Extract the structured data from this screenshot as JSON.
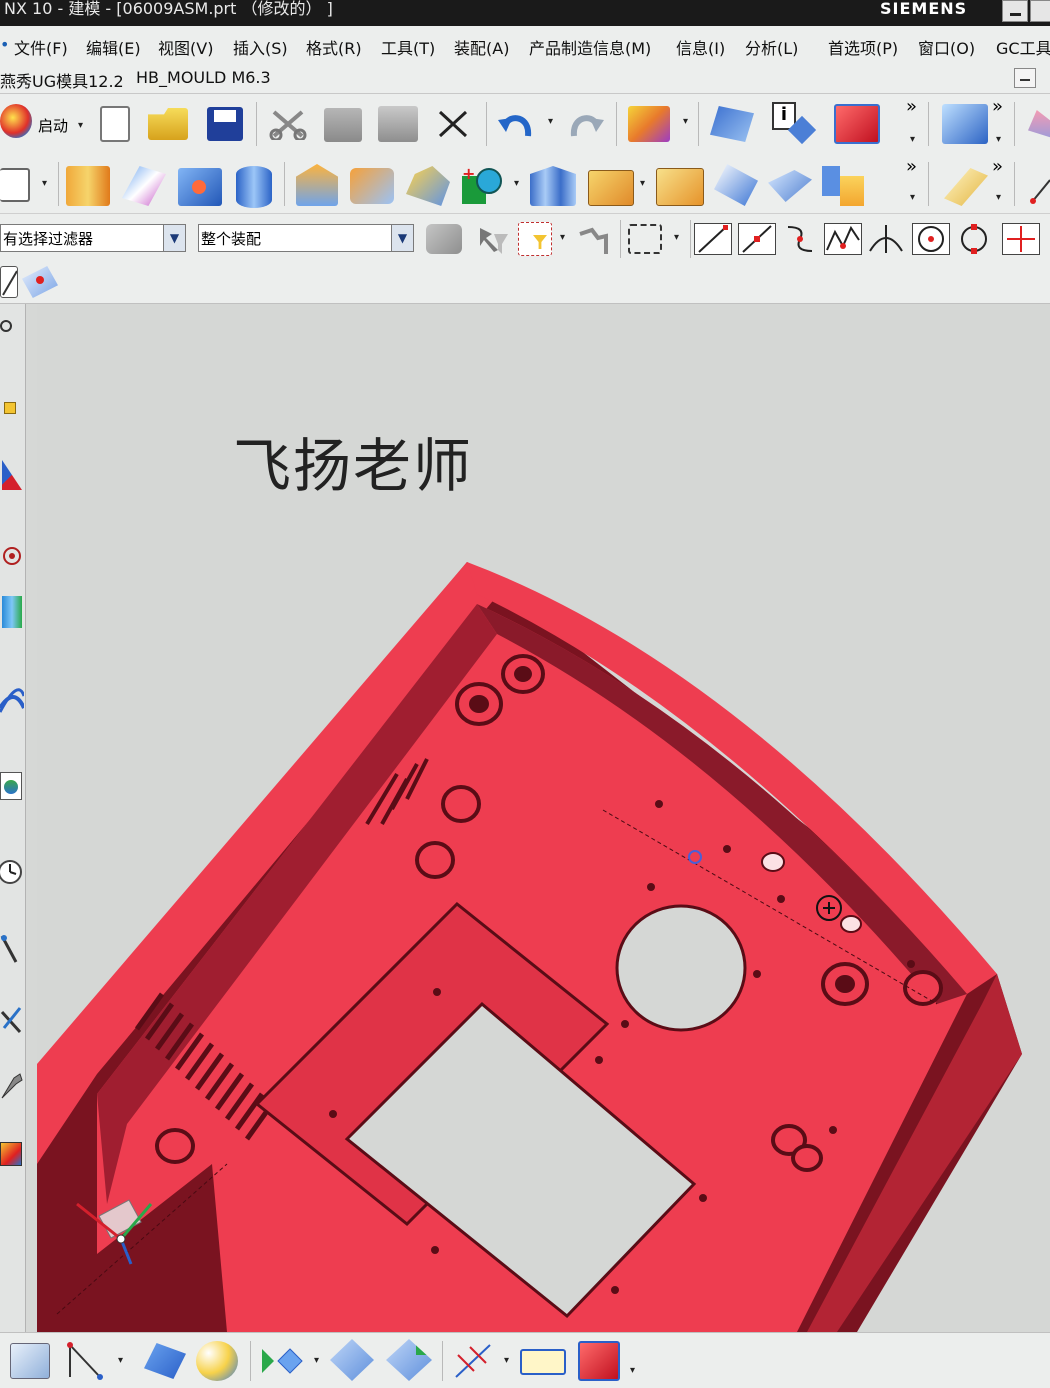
{
  "window": {
    "title": "NX 10 - 建模 - [06009ASM.prt （修改的） ]",
    "brand": "SIEMENS"
  },
  "menu": [
    "文件(F)",
    "编辑(E)",
    "视图(V)",
    "插入(S)",
    "格式(R)",
    "工具(T)",
    "装配(A)",
    "产品制造信息(M)",
    "信息(I)",
    "分析(L)",
    "首选项(P)",
    "窗口(O)",
    "GC工具"
  ],
  "plugins": {
    "ug_mold": "燕秀UG模具12.2",
    "hb_mould": "HB_MOULD M6.3"
  },
  "toolbar": {
    "start_label": "启动",
    "more_chevron": "»"
  },
  "selection": {
    "filter_value": "有选择过滤器",
    "scope_value": "整个装配"
  },
  "viewport": {
    "watermark": "飞扬老师"
  },
  "colors": {
    "part": "#ee3d50",
    "part_dark": "#7a1320",
    "part_mid": "#c02a3a",
    "background": "#d5d7d5"
  }
}
